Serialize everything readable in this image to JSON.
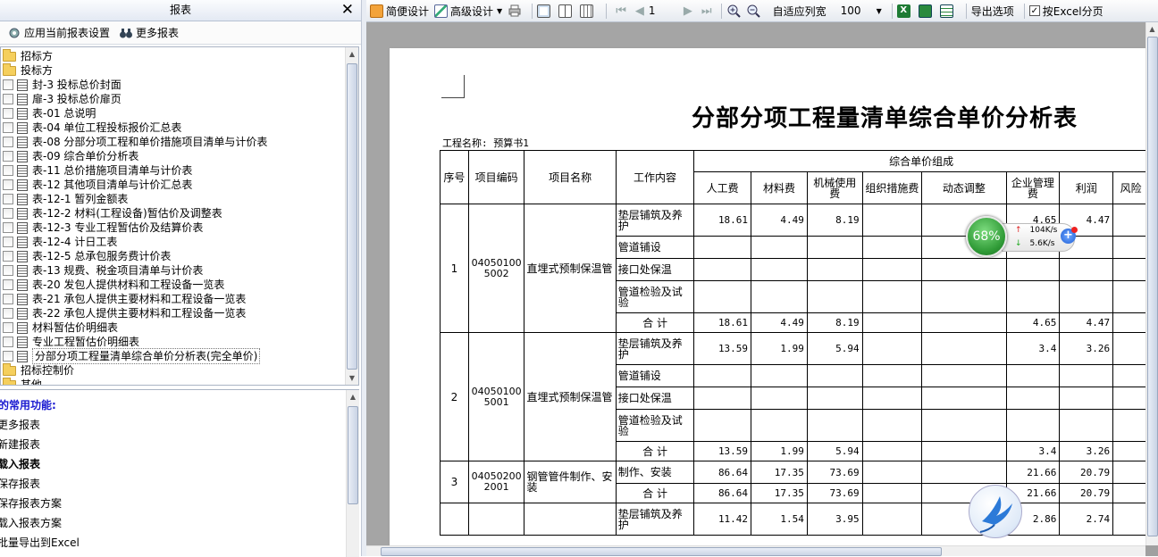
{
  "left_panel": {
    "title": "报表",
    "close": "✕",
    "toolbar": {
      "apply_settings": "应用当前报表设置",
      "more_reports": "更多报表"
    },
    "tree": [
      {
        "type": "folder",
        "label": "招标方",
        "indent": 0
      },
      {
        "type": "folder",
        "label": "投标方",
        "indent": 0
      },
      {
        "type": "report",
        "label": "封-3 投标总价封面"
      },
      {
        "type": "report",
        "label": "扉-3 投标总价扉页"
      },
      {
        "type": "report",
        "label": "表-01 总说明"
      },
      {
        "type": "report",
        "label": "表-04 单位工程投标报价汇总表"
      },
      {
        "type": "report",
        "label": "表-08 分部分项工程和单价措施项目清单与计价表"
      },
      {
        "type": "report",
        "label": "表-09 综合单价分析表"
      },
      {
        "type": "report",
        "label": "表-11 总价措施项目清单与计价表"
      },
      {
        "type": "report",
        "label": "表-12 其他项目清单与计价汇总表"
      },
      {
        "type": "report",
        "label": "表-12-1 暂列金额表"
      },
      {
        "type": "report",
        "label": "表-12-2 材料(工程设备)暂估价及调整表"
      },
      {
        "type": "report",
        "label": "表-12-3 专业工程暂估价及结算价表"
      },
      {
        "type": "report",
        "label": "表-12-4 计日工表"
      },
      {
        "type": "report",
        "label": "表-12-5 总承包服务费计价表"
      },
      {
        "type": "report",
        "label": "表-13 规费、税金项目清单与计价表"
      },
      {
        "type": "report",
        "label": "表-20 发包人提供材料和工程设备一览表"
      },
      {
        "type": "report",
        "label": "表-21 承包人提供主要材料和工程设备一览表"
      },
      {
        "type": "report",
        "label": "表-22 承包人提供主要材料和工程设备一览表"
      },
      {
        "type": "report",
        "label": "材料暂估价明细表"
      },
      {
        "type": "report",
        "label": "专业工程暂估价明细表"
      },
      {
        "type": "report",
        "label": "分部分项工程量清单综合单价分析表(完全单价)",
        "selected": true
      },
      {
        "type": "folder",
        "label": "招标控制价",
        "indent": 0
      },
      {
        "type": "folder",
        "label": "其他",
        "indent": 0
      }
    ],
    "common": {
      "title": "的常用功能:",
      "items": [
        "更多报表",
        "新建报表",
        "载入报表",
        "保存报表",
        "保存报表方案",
        "载入报表方案",
        "批量导出到Excel"
      ]
    }
  },
  "toolbar": {
    "simple_design": "简便设计",
    "advanced_design": "高级设计",
    "page": "1",
    "fit_width": "自适应列宽",
    "zoom": "100",
    "export_options": "导出选项",
    "excel_paging": "按Excel分页"
  },
  "report": {
    "title": "分部分项工程量清单综合单价分析表",
    "project_label": "工程名称: 预算书1",
    "headers": {
      "seq": "序号",
      "code": "项目编码",
      "name": "项目名称",
      "work": "工作内容",
      "group": "综合单价组成",
      "cols": [
        "人工费",
        "材料费",
        "机械使用费",
        "组织措施费",
        "动态调整",
        "企业管理费",
        "利润",
        "风险"
      ]
    },
    "sections": [
      {
        "seq": "1",
        "code": "040501005002",
        "name": "直埋式预制保温管",
        "rows": [
          {
            "work": "垫层铺筑及养护",
            "vals": [
              "18.61",
              "4.49",
              "8.19",
              "",
              "",
              "4.65",
              "4.47",
              ""
            ]
          },
          {
            "work": "管道铺设",
            "vals": [
              "",
              "",
              "",
              "",
              "",
              "",
              "",
              ""
            ]
          },
          {
            "work": "接口处保温",
            "vals": [
              "",
              "",
              "",
              "",
              "",
              "",
              "",
              ""
            ]
          },
          {
            "work": "管道检验及试验",
            "vals": [
              "",
              "",
              "",
              "",
              "",
              "",
              "",
              ""
            ]
          },
          {
            "work": "合 计",
            "total": true,
            "vals": [
              "18.61",
              "4.49",
              "8.19",
              "",
              "",
              "4.65",
              "4.47",
              ""
            ]
          }
        ]
      },
      {
        "seq": "2",
        "code": "040501005001",
        "name": "直埋式预制保温管",
        "rows": [
          {
            "work": "垫层铺筑及养护",
            "vals": [
              "13.59",
              "1.99",
              "5.94",
              "",
              "",
              "3.4",
              "3.26",
              ""
            ]
          },
          {
            "work": "管道铺设",
            "vals": [
              "",
              "",
              "",
              "",
              "",
              "",
              "",
              ""
            ]
          },
          {
            "work": "接口处保温",
            "vals": [
              "",
              "",
              "",
              "",
              "",
              "",
              "",
              ""
            ]
          },
          {
            "work": "管道检验及试验",
            "vals": [
              "",
              "",
              "",
              "",
              "",
              "",
              "",
              ""
            ]
          },
          {
            "work": "合 计",
            "total": true,
            "vals": [
              "13.59",
              "1.99",
              "5.94",
              "",
              "",
              "3.4",
              "3.26",
              ""
            ]
          }
        ]
      },
      {
        "seq": "3",
        "code": "040502002001",
        "name": "钢管管件制作、安装",
        "rows": [
          {
            "work": "制作、安装",
            "vals": [
              "86.64",
              "17.35",
              "73.69",
              "",
              "",
              "21.66",
              "20.79",
              ""
            ]
          },
          {
            "work": "合 计",
            "total": true,
            "vals": [
              "86.64",
              "17.35",
              "73.69",
              "",
              "",
              "21.66",
              "20.79",
              ""
            ]
          }
        ]
      },
      {
        "seq": "",
        "code": "",
        "name": "",
        "rows": [
          {
            "work": "垫层铺筑及养护",
            "vals": [
              "11.42",
              "1.54",
              "3.95",
              "",
              "",
              "2.86",
              "2.74",
              ""
            ]
          }
        ]
      }
    ]
  },
  "speed_widget": {
    "percent": "68%",
    "up": "104K/s",
    "down": "5.6K/s"
  }
}
